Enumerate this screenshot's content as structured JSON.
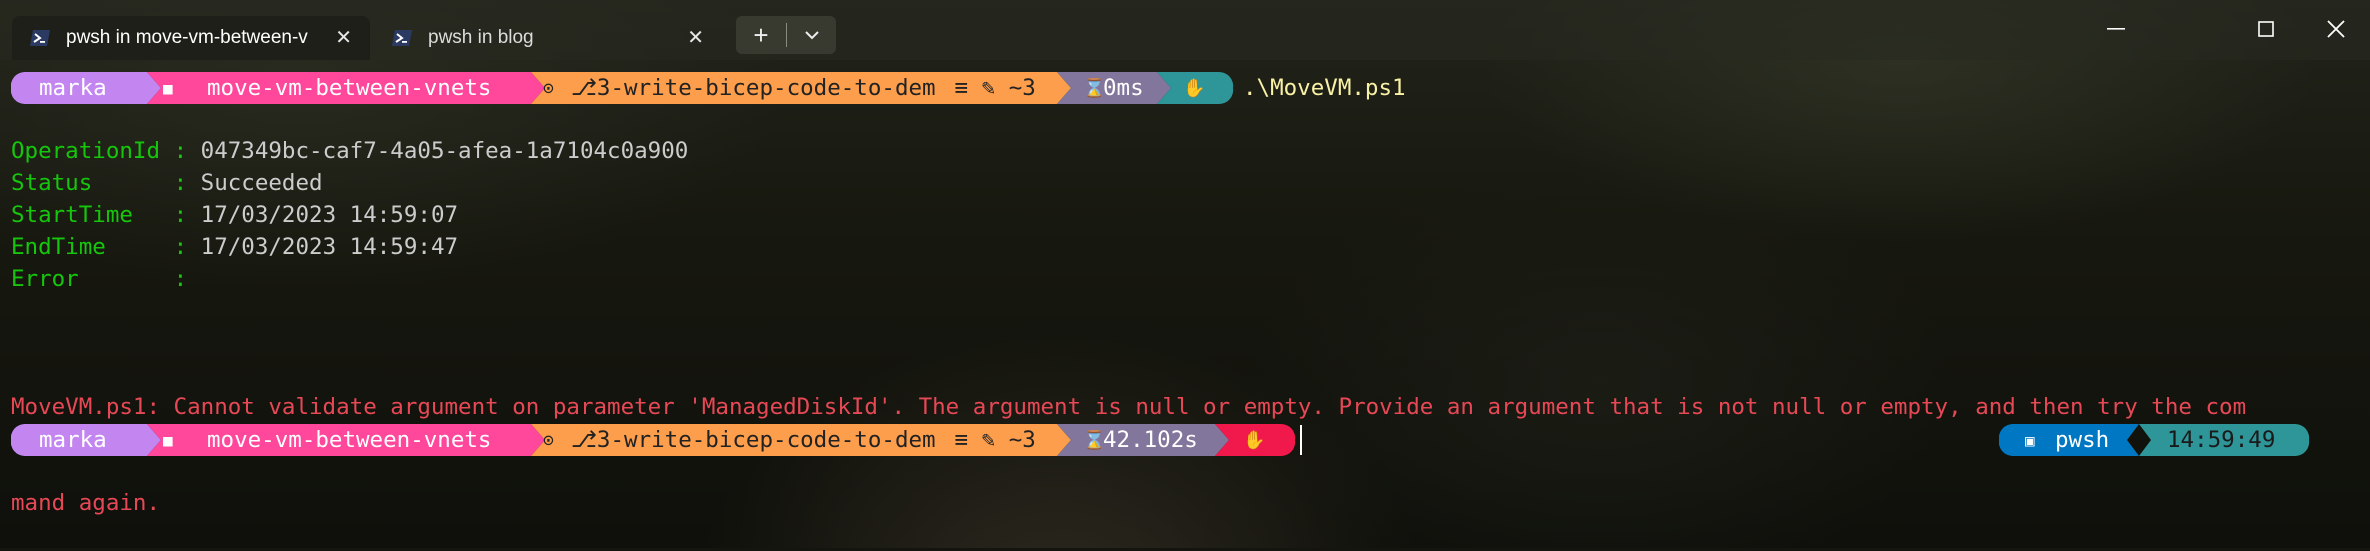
{
  "tabs": [
    {
      "title": "pwsh in move-vm-between-v",
      "icon": "powershell-icon",
      "active": true
    },
    {
      "title": "pwsh in blog",
      "icon": "powershell-icon",
      "active": false
    }
  ],
  "tab_close": "✕",
  "new_tab": "+",
  "window": {
    "minimize": "─",
    "maximize": "☐",
    "close": "✕"
  },
  "prompt1": {
    "user": "marka",
    "folder_icon": "■",
    "folder": "move-vm-between-vnets",
    "git_icon": "⊙",
    "branch": "⎇3-write-bicep-code-to-dem",
    "git_status": " ≡ ✎ ~3 ",
    "hourglass": "⌛",
    "duration": "0ms",
    "status_icon": "✋",
    "command": ".\\MoveVM.ps1"
  },
  "output": [
    {
      "key": "OperationId ",
      "sep": ": ",
      "value": "047349bc-caf7-4a05-afea-1a7104c0a900"
    },
    {
      "key": "Status      ",
      "sep": ": ",
      "value": "Succeeded"
    },
    {
      "key": "StartTime   ",
      "sep": ": ",
      "value": "17/03/2023 14:59:07"
    },
    {
      "key": "EndTime     ",
      "sep": ": ",
      "value": "17/03/2023 14:59:47"
    },
    {
      "key": "Error       ",
      "sep": ": ",
      "value": ""
    }
  ],
  "error": {
    "line1": "MoveVM.ps1: Cannot validate argument on parameter 'ManagedDiskId'. The argument is null or empty. Provide an argument that is not null or empty, and then try the com",
    "line2": "mand again."
  },
  "prompt2": {
    "user": "marka",
    "folder_icon": "■",
    "folder": "move-vm-between-vnets",
    "git_icon": "⊙",
    "branch": "⎇3-write-bicep-code-to-dem",
    "git_status": " ≡ ✎ ~3 ",
    "hourglass": "⌛",
    "duration": "42.102s",
    "status_icon": "✋",
    "shell_icon": "▣",
    "shell": "pwsh",
    "time": "14:59:49"
  },
  "colors": {
    "user_bg": "#c386f1",
    "folder_bg": "#ff479c",
    "git_bg": "#fc9e4c",
    "exec_bg": "#83769c",
    "status_ok_bg": "#2e9599",
    "status_err_bg": "#f1184c",
    "shell_bg": "#0077c2",
    "time_bg": "#2e9599"
  }
}
